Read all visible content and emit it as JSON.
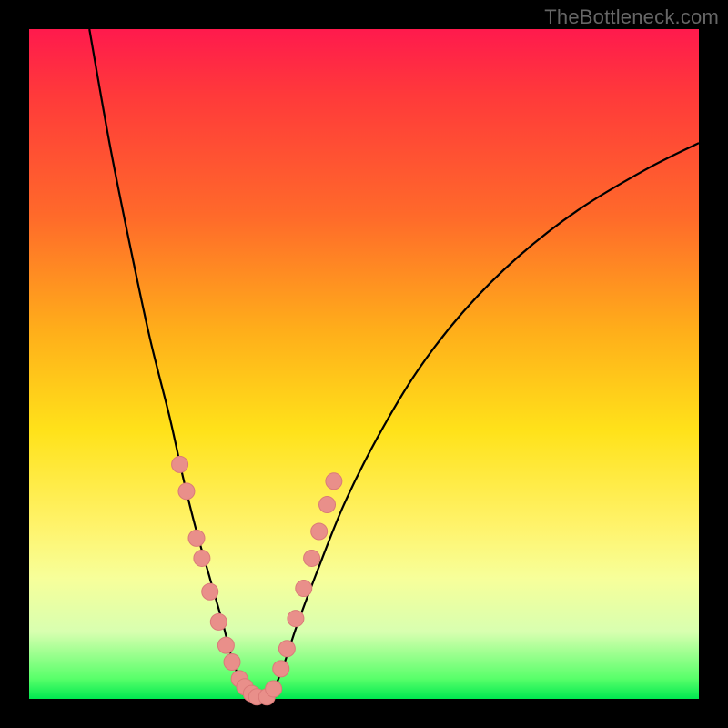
{
  "watermark": "TheBottleneck.com",
  "chart_data": {
    "type": "line",
    "title": "",
    "xlabel": "",
    "ylabel": "",
    "xlim": [
      0,
      100
    ],
    "ylim": [
      0,
      100
    ],
    "grid": false,
    "legend": null,
    "curve_left": {
      "x": [
        9,
        12,
        15,
        18,
        21,
        23,
        25,
        27,
        29,
        30,
        31,
        32,
        33
      ],
      "y": [
        100,
        83,
        68,
        54,
        42,
        33,
        25,
        18,
        11,
        7,
        4,
        2,
        0
      ]
    },
    "curve_right": {
      "x": [
        36,
        38,
        40,
        43,
        47,
        52,
        58,
        65,
        73,
        82,
        92,
        100
      ],
      "y": [
        0,
        5,
        11,
        19,
        29,
        39,
        49,
        58,
        66,
        73,
        79,
        83
      ]
    },
    "flat_bottom": {
      "x": [
        33,
        36
      ],
      "y": [
        0,
        0
      ]
    },
    "dots_left": {
      "x": [
        22.5,
        23.5,
        25.0,
        25.8,
        27.0,
        28.3,
        29.4,
        30.3,
        31.4,
        32.2,
        33.2,
        34.0
      ],
      "y": [
        35.0,
        31.0,
        24.0,
        21.0,
        16.0,
        11.5,
        8.0,
        5.5,
        3.0,
        1.8,
        0.8,
        0.3
      ]
    },
    "dots_right": {
      "x": [
        35.5,
        36.5,
        37.6,
        38.5,
        39.8,
        41.0,
        42.2,
        43.3,
        44.5,
        45.5
      ],
      "y": [
        0.3,
        1.5,
        4.5,
        7.5,
        12.0,
        16.5,
        21.0,
        25.0,
        29.0,
        32.5
      ]
    },
    "gradient_stops": [
      {
        "pct": 0,
        "color": "#ff1a4d"
      },
      {
        "pct": 10,
        "color": "#ff3a3a"
      },
      {
        "pct": 28,
        "color": "#ff6a2a"
      },
      {
        "pct": 45,
        "color": "#ffae1a"
      },
      {
        "pct": 60,
        "color": "#ffe21a"
      },
      {
        "pct": 74,
        "color": "#fff36a"
      },
      {
        "pct": 82,
        "color": "#f7ff9a"
      },
      {
        "pct": 90,
        "color": "#d8ffb0"
      },
      {
        "pct": 97,
        "color": "#58ff6a"
      },
      {
        "pct": 100,
        "color": "#00e850"
      }
    ]
  }
}
